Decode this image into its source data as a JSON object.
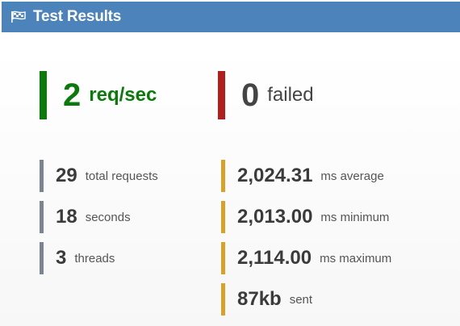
{
  "header": {
    "title": "Test Results",
    "icon": "flag-icon"
  },
  "summary": {
    "rate": {
      "value": "2",
      "unit": "req/sec",
      "color": "#0a7a0a"
    },
    "failed": {
      "value": "0",
      "unit": "failed",
      "color": "#b01e1e"
    }
  },
  "left_stats": [
    {
      "value": "29",
      "label": "total requests"
    },
    {
      "value": "18",
      "label": "seconds"
    },
    {
      "value": "3",
      "label": "threads"
    }
  ],
  "right_stats": [
    {
      "value": "2,024.31",
      "label": "ms average"
    },
    {
      "value": "2,013.00",
      "label": "ms minimum"
    },
    {
      "value": "2,114.00",
      "label": "ms maximum"
    },
    {
      "value": "87kb",
      "label": "sent"
    }
  ],
  "colors": {
    "header_bg": "#4c83ba",
    "neutral_bar": "#7a8590",
    "timing_bar": "#d9a227"
  }
}
